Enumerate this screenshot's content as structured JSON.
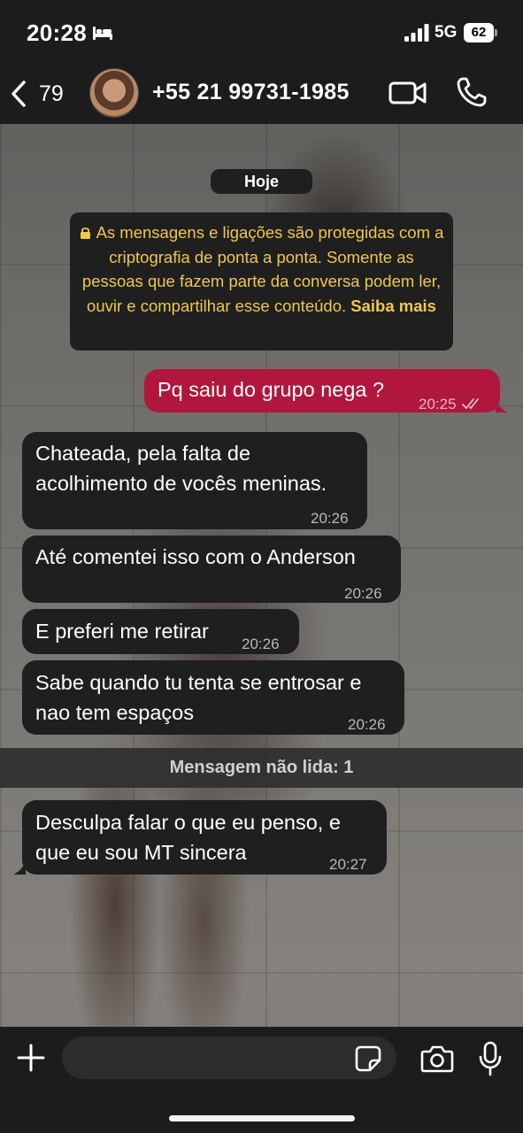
{
  "status_bar": {
    "time": "20:28",
    "sleep_icon": "bed-icon",
    "signal_icon": "signal-bars-icon",
    "network": "5G",
    "battery": "62"
  },
  "header": {
    "back_icon": "chevron-left-icon",
    "unread_count": "79",
    "contact": "+55 21 99731-1985",
    "video_icon": "video-camera-icon",
    "call_icon": "phone-icon"
  },
  "chat": {
    "date_label": "Hoje",
    "encryption": {
      "icon": "lock-icon",
      "text": "As mensagens e ligações são protegidas com a criptografia de ponta a ponta. Somente as pessoas que fazem parte da conversa podem ler, ouvir e compartilhar esse conteúdo.",
      "link": "Saiba mais"
    },
    "messages": [
      {
        "direction": "out",
        "lines": [
          "Pq saiu do grupo nega ?"
        ],
        "time": "20:25",
        "status": "read"
      },
      {
        "direction": "in",
        "lines": [
          "Chateada, pela falta de",
          "acolhimento de vocês meninas."
        ],
        "time": "20:26"
      },
      {
        "direction": "in",
        "lines": [
          "Até comentei isso com o Anderson"
        ],
        "time": "20:26"
      },
      {
        "direction": "in",
        "lines": [
          "E preferi me retirar"
        ],
        "time": "20:26"
      },
      {
        "direction": "in",
        "lines": [
          "Sabe quando tu tenta se entrosar e",
          "nao tem espaços"
        ],
        "time": "20:26"
      },
      {
        "direction": "in",
        "lines": [
          "Desculpa falar o que eu penso, e",
          "que eu sou MT sincera"
        ],
        "time": "20:27"
      }
    ],
    "unread_label": "Mensagem não lida: 1"
  },
  "composer": {
    "attach_icon": "plus-icon",
    "input_value": "",
    "sticker_icon": "sticker-icon",
    "camera_icon": "camera-icon",
    "mic_icon": "microphone-icon"
  },
  "colors": {
    "outgoing_bubble": "#b1163c",
    "incoming_bubble": "#1f1f1f",
    "encryption_text": "#f0c84a",
    "bars": "#1c1c1e"
  }
}
